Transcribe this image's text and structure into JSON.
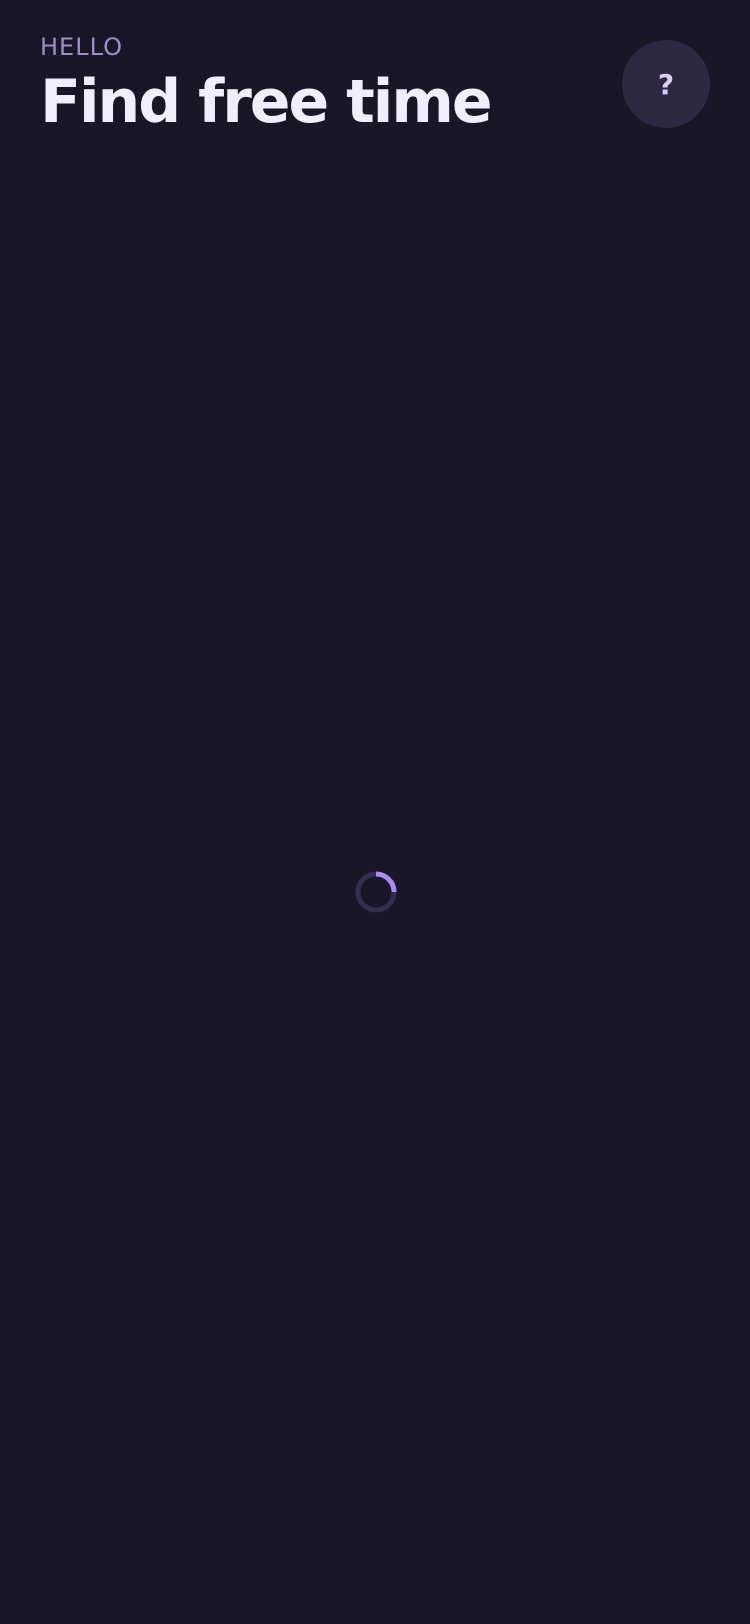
{
  "header": {
    "greeting": "HELLO",
    "title": "Find free time"
  },
  "help_button": {
    "label": "?"
  },
  "loading": {
    "icon": "loading-spinner-icon",
    "progress_fraction": 0.25
  },
  "colors": {
    "background": "#191627",
    "greeting": "#9a8fc7",
    "title": "#f1eefc",
    "help_button_bg": "#2c2841",
    "spinner_track": "#332e4f",
    "spinner_accent": "#a78bf0"
  }
}
